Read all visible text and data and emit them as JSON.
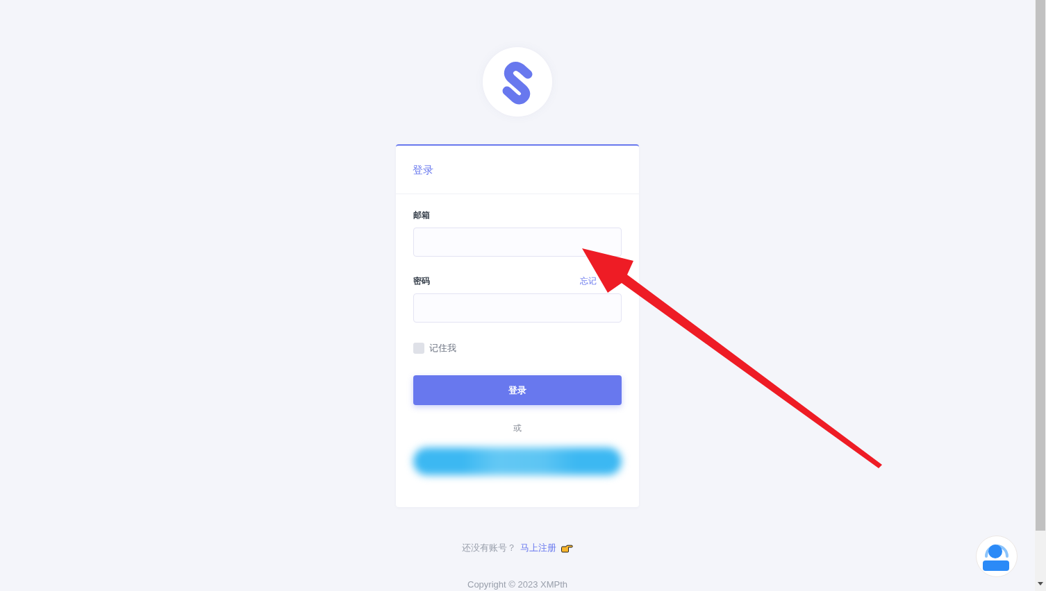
{
  "login_card": {
    "title": "登录",
    "fields": [
      {
        "label": "邮箱"
      },
      {
        "label": "密码",
        "link": "忘记"
      }
    ],
    "remember_me": {
      "label": "记住我",
      "checked": false
    },
    "submit_button": "登录",
    "divider": "或"
  },
  "footer": {
    "prompt": "还没有账号？",
    "register_link": "马上注册",
    "copyright": "Copyright © 2023 XMPth"
  }
}
